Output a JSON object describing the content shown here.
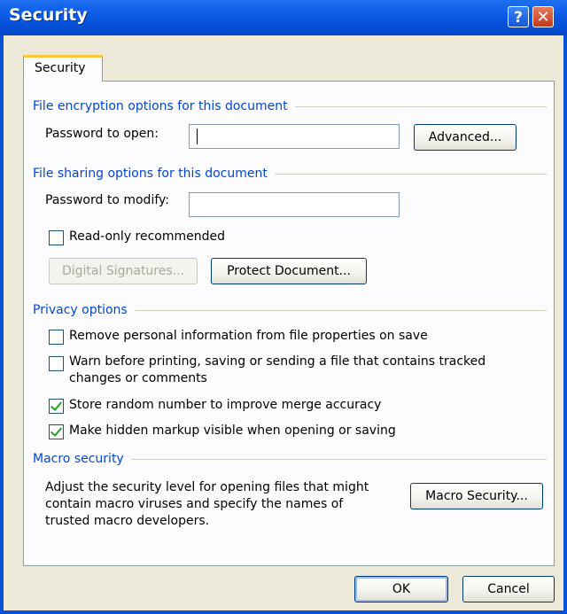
{
  "window": {
    "title": "Security",
    "help_glyph": "?",
    "close_glyph": "✕"
  },
  "tab": {
    "label": "Security"
  },
  "encryption": {
    "group_label": "File encryption options for this document",
    "password_label": "Password to open:",
    "password_value": "",
    "advanced_label": "Advanced..."
  },
  "sharing": {
    "group_label": "File sharing options for this document",
    "modify_label": "Password to modify:",
    "modify_value": "",
    "readonly_label": "Read-only recommended",
    "readonly_checked": false,
    "signatures_label": "Digital Signatures...",
    "protect_label": "Protect Document..."
  },
  "privacy": {
    "group_label": "Privacy options",
    "options": [
      {
        "label": "Remove personal information from file properties on save",
        "checked": false
      },
      {
        "label": "Warn before printing, saving or sending a file that contains tracked",
        "label2": "changes or comments",
        "checked": false
      },
      {
        "label": "Store random number to improve merge accuracy",
        "checked": true
      },
      {
        "label": "Make hidden markup visible when opening or saving",
        "checked": true
      }
    ]
  },
  "macro": {
    "group_label": "Macro security",
    "desc_line1": "Adjust the security level for opening files that might",
    "desc_line2": "contain macro viruses and specify the names of",
    "desc_line3": "trusted macro developers.",
    "button_label": "Macro Security..."
  },
  "footer": {
    "ok_label": "OK",
    "cancel_label": "Cancel"
  },
  "colors": {
    "titlebar": "#0a5ae6",
    "group_text": "#0046d5",
    "dialog_face": "#ece9d8",
    "check_mark": "#21a121"
  }
}
